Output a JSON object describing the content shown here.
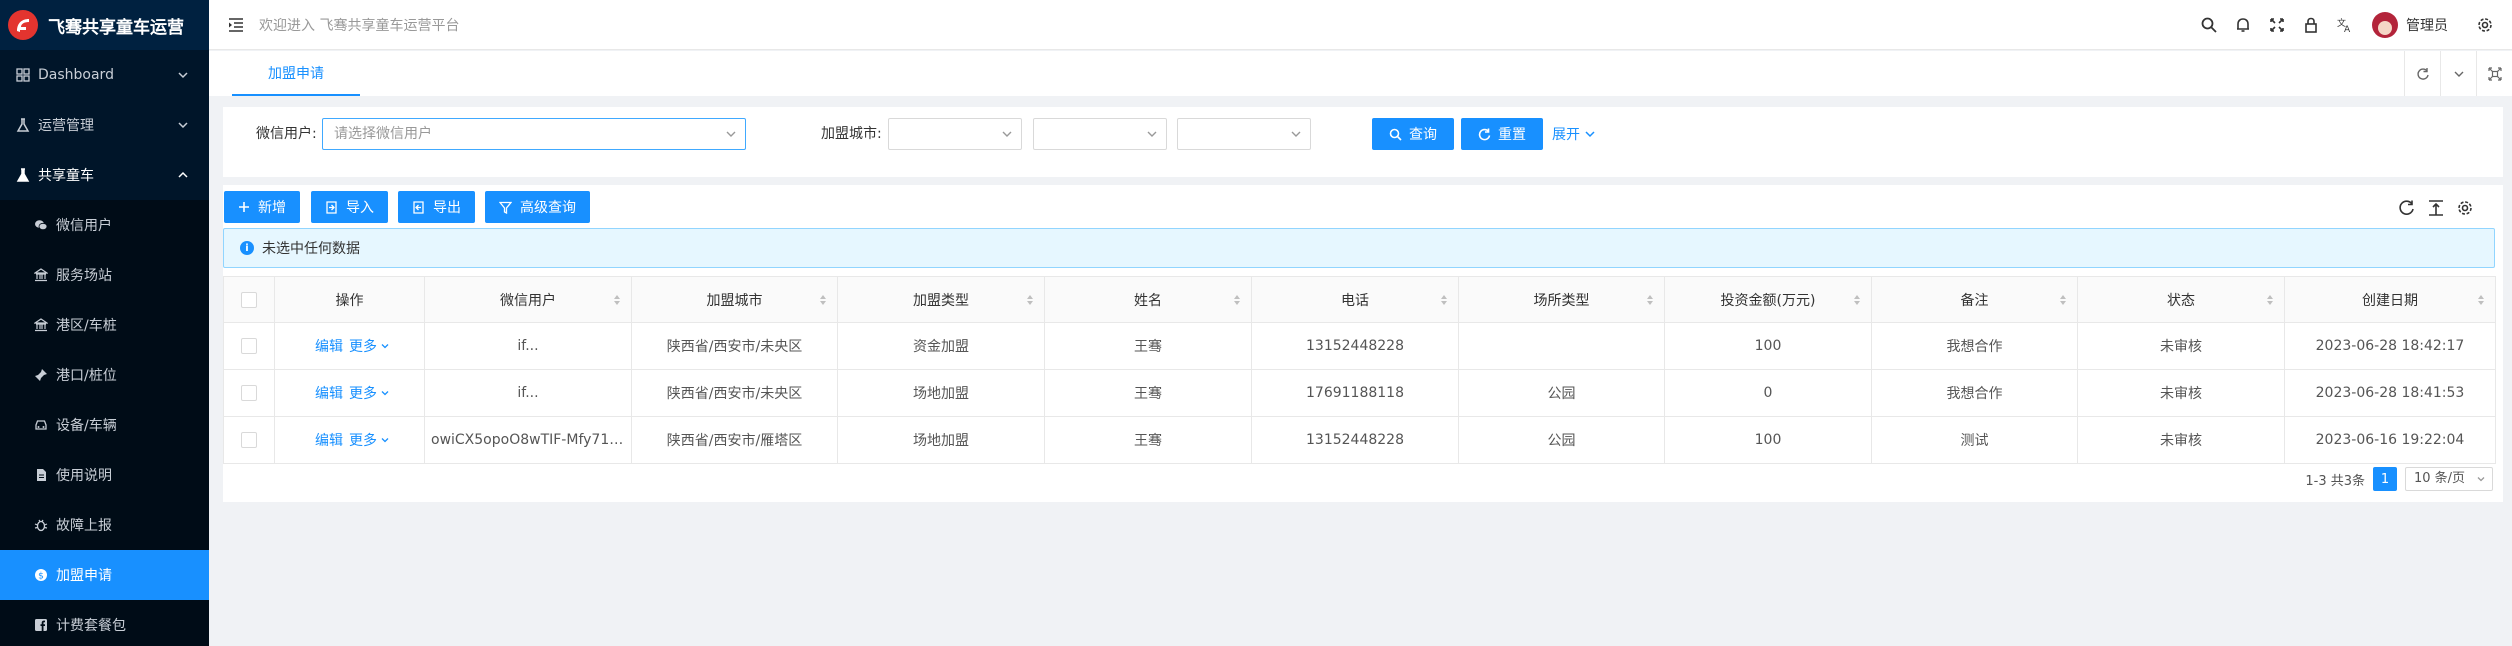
{
  "app": {
    "title": "飞骞共享童车运营",
    "welcome": "欢迎进入 飞骞共享童车运营平台"
  },
  "sidebar": {
    "items": [
      {
        "label": "Dashboard",
        "icon": "dashboard-icon"
      },
      {
        "label": "运营管理",
        "icon": "flask-icon"
      },
      {
        "label": "共享童车",
        "icon": "flask-icon"
      }
    ],
    "submenu": [
      {
        "label": "微信用户",
        "icon": "wechat-icon"
      },
      {
        "label": "服务场站",
        "icon": "bank-icon"
      },
      {
        "label": "港区/车桩",
        "icon": "bank-icon"
      },
      {
        "label": "港口/桩位",
        "icon": "pin-icon"
      },
      {
        "label": "设备/车辆",
        "icon": "car-icon"
      },
      {
        "label": "使用说明",
        "icon": "file-icon"
      },
      {
        "label": "故障上报",
        "icon": "bug-icon"
      },
      {
        "label": "加盟申请",
        "icon": "dollar-icon"
      },
      {
        "label": "计费套餐包",
        "icon": "facebook-icon"
      }
    ],
    "active": "加盟申请"
  },
  "header": {
    "admin": "管理员"
  },
  "tabs": [
    {
      "label": "加盟申请"
    }
  ],
  "search": {
    "wechat_label": "微信用户:",
    "wechat_placeholder": "请选择微信用户",
    "city_label": "加盟城市:",
    "query_btn": "查询",
    "reset_btn": "重置",
    "expand_link": "展开"
  },
  "toolbar": {
    "add": "新增",
    "import": "导入",
    "export": "导出",
    "advanced": "高级查询"
  },
  "alert": {
    "text": "未选中任何数据"
  },
  "table": {
    "columns": [
      "操作",
      "微信用户",
      "加盟城市",
      "加盟类型",
      "姓名",
      "电话",
      "场所类型",
      "投资金额(万元)",
      "备注",
      "状态",
      "创建日期"
    ],
    "edit_label": "编辑",
    "more_label": "更多",
    "rows": [
      {
        "wechat": "if...",
        "city": "陕西省/西安市/未央区",
        "type": "资金加盟",
        "name": "王骞",
        "phone": "13152448228",
        "place": "",
        "amount": "100",
        "note": "我想合作",
        "status": "未审核",
        "date": "2023-06-28 18:42:17"
      },
      {
        "wechat": "if...",
        "city": "陕西省/西安市/未央区",
        "type": "场地加盟",
        "name": "王骞",
        "phone": "17691188118",
        "place": "公园",
        "amount": "0",
        "note": "我想合作",
        "status": "未审核",
        "date": "2023-06-28 18:41:53"
      },
      {
        "wechat": "owiCX5opoO8wTIF-Mfy71_4...",
        "city": "陕西省/西安市/雁塔区",
        "type": "场地加盟",
        "name": "王骞",
        "phone": "13152448228",
        "place": "公园",
        "amount": "100",
        "note": "测试",
        "status": "未审核",
        "date": "2023-06-16 19:22:04"
      }
    ]
  },
  "pagination": {
    "summary": "1-3 共3条",
    "current": "1",
    "page_size": "10 条/页"
  },
  "colors": {
    "primary": "#1890ff",
    "sidebar": "#001529",
    "logo": "#e3342f"
  }
}
